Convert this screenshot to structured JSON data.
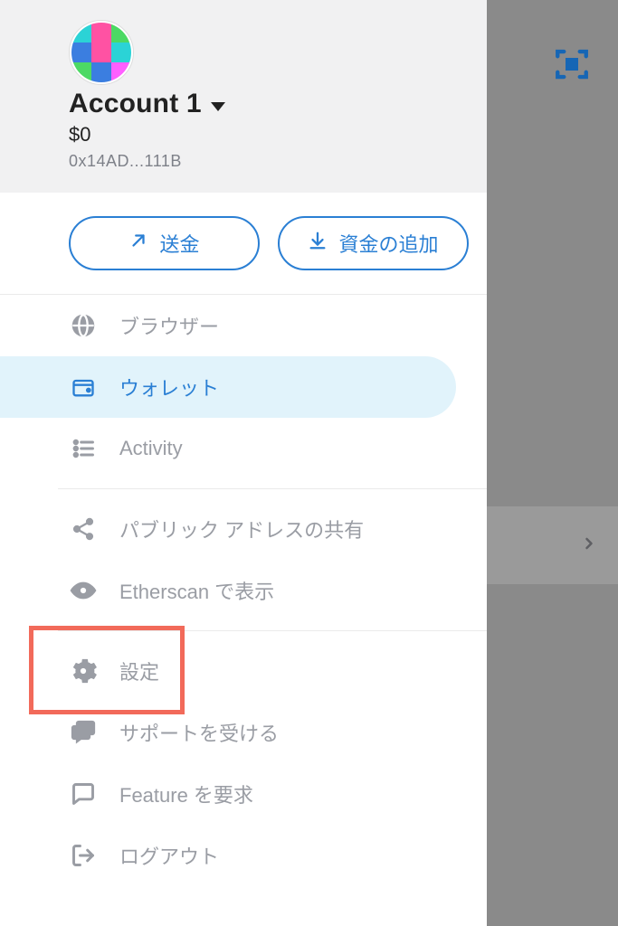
{
  "account": {
    "name": "Account 1",
    "balance": "$0",
    "address": "0x14AD...111B"
  },
  "actions": {
    "send": "送金",
    "add_funds": "資金の追加"
  },
  "menu": {
    "browser": "ブラウザー",
    "wallet": "ウォレット",
    "activity": "Activity",
    "share_address": "パブリック アドレスの共有",
    "etherscan": "Etherscan で表示",
    "settings": "設定",
    "support": "サポートを受ける",
    "feature_request": "Feature を要求",
    "logout": "ログアウト"
  }
}
